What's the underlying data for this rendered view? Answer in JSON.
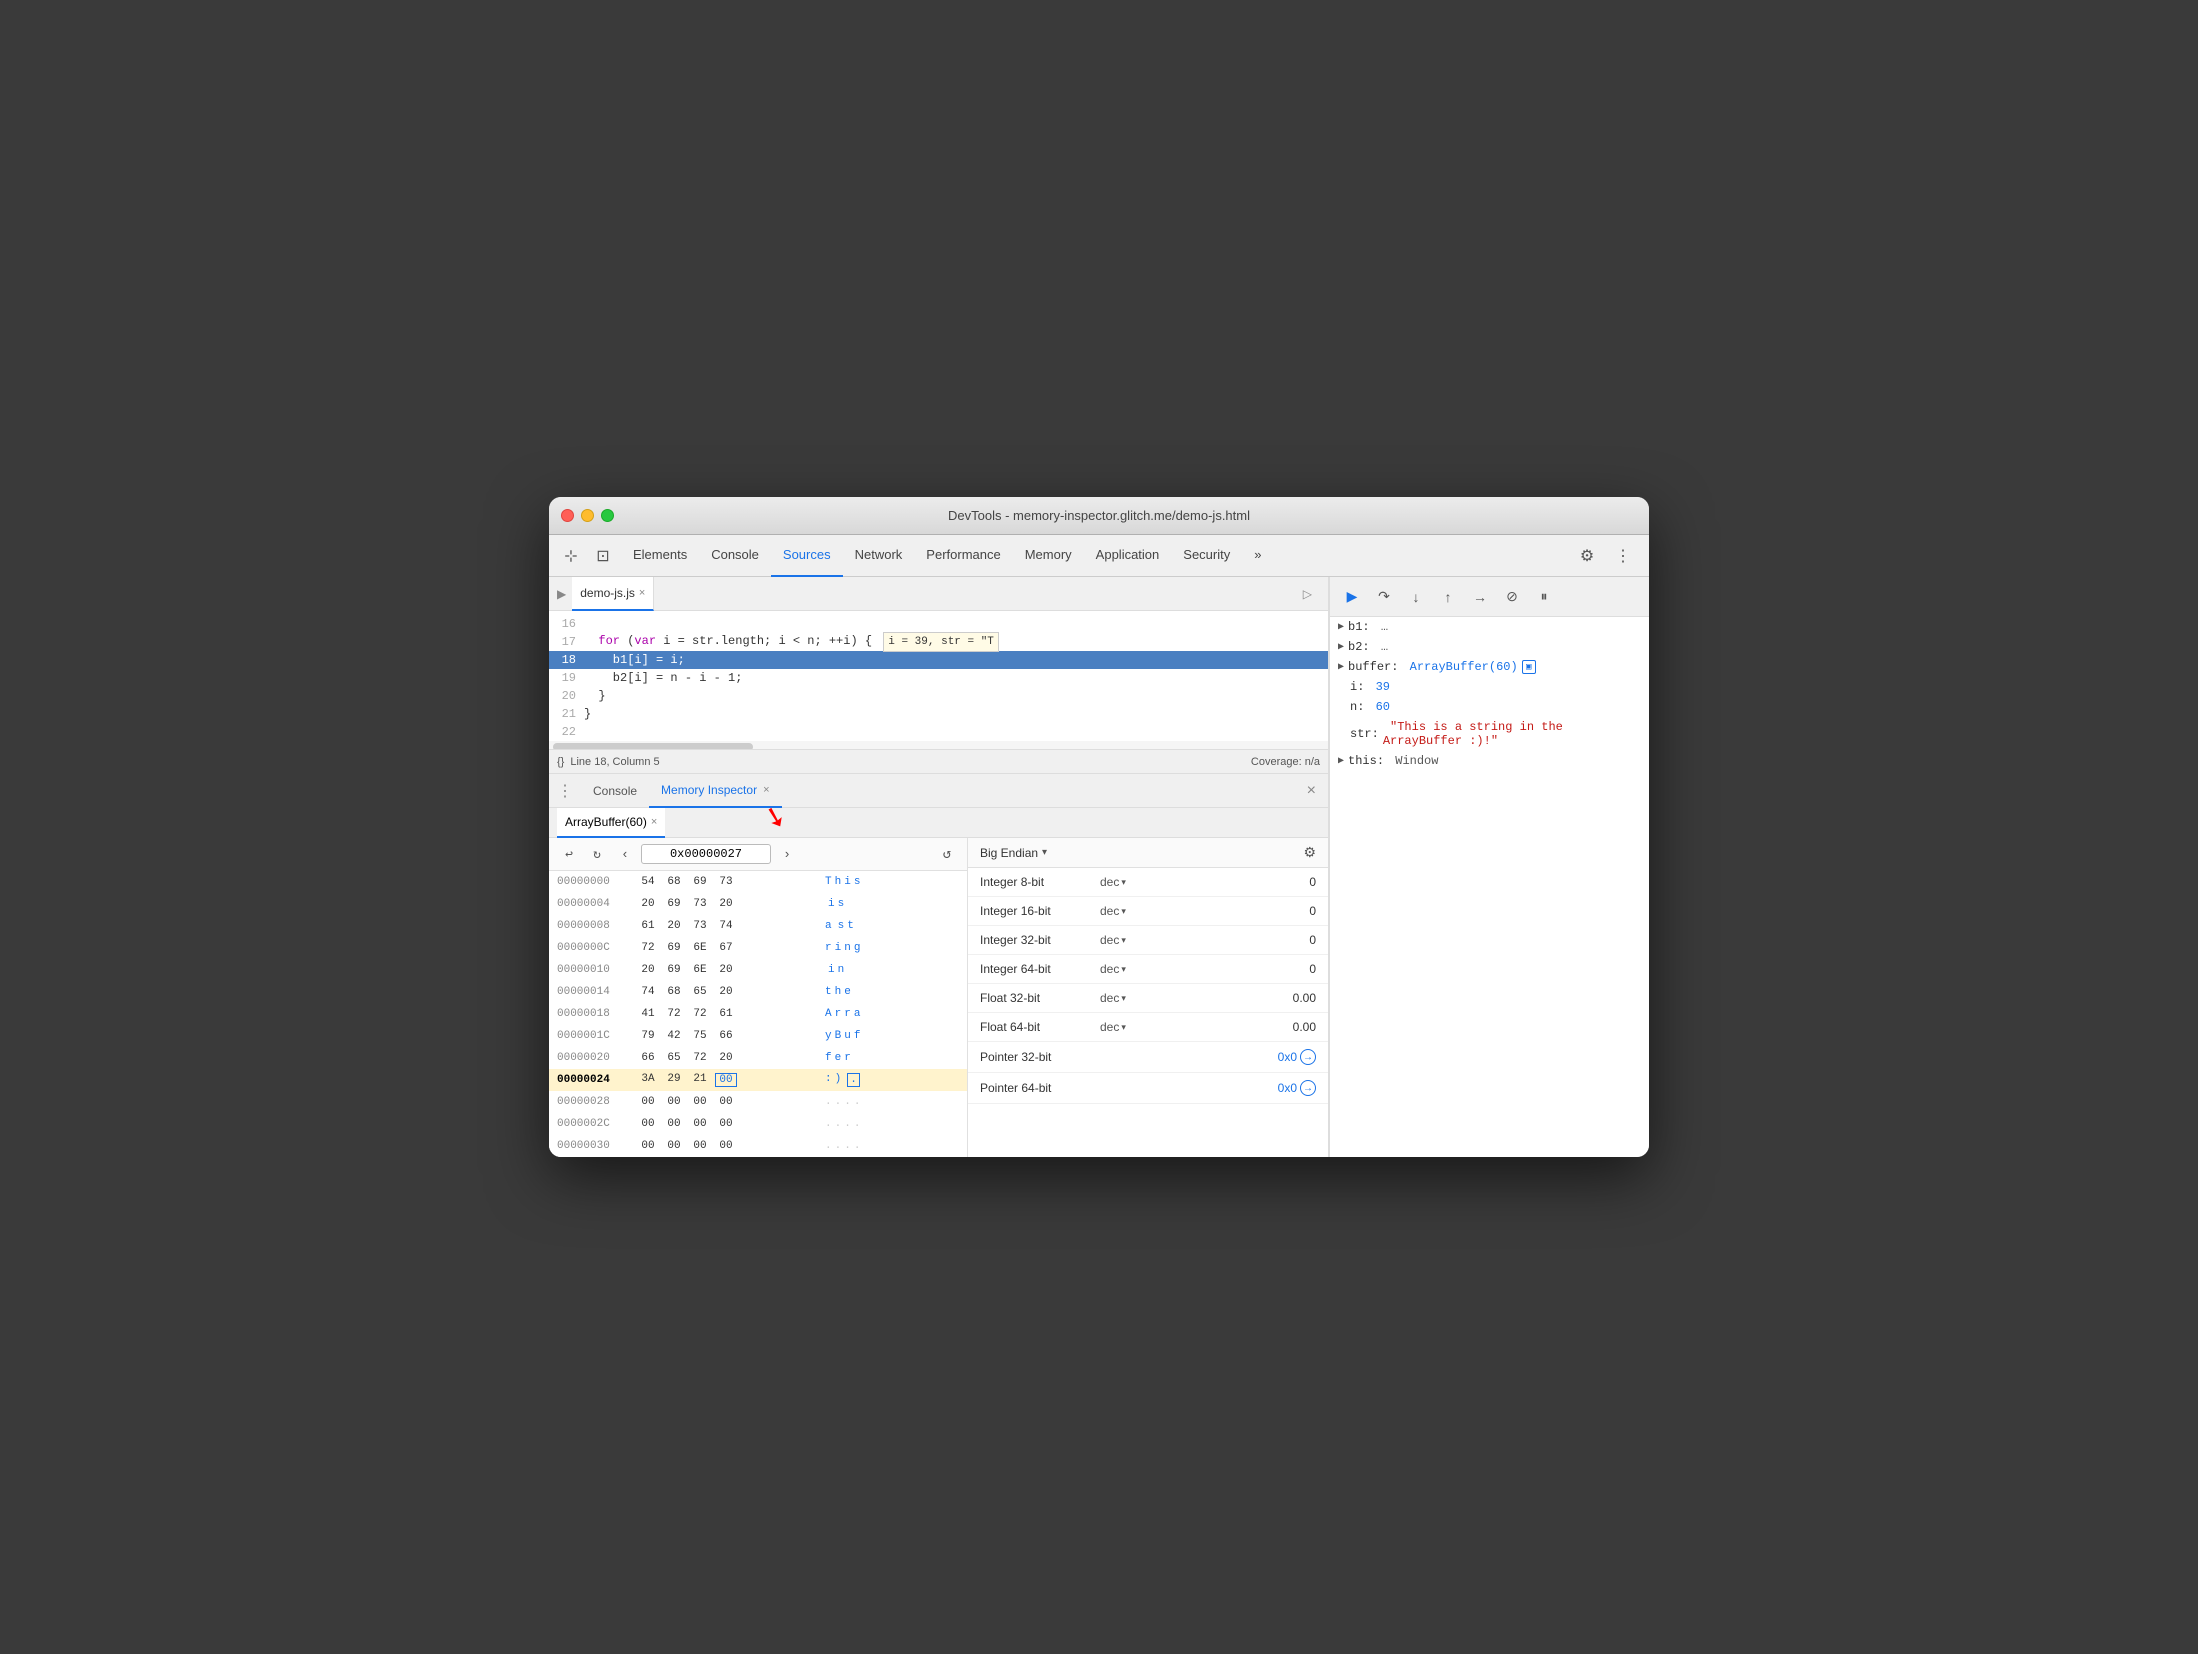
{
  "window": {
    "title": "DevTools - memory-inspector.glitch.me/demo-js.html"
  },
  "devtools_tabs": {
    "items": [
      {
        "label": "Elements",
        "active": false
      },
      {
        "label": "Console",
        "active": false
      },
      {
        "label": "Sources",
        "active": true
      },
      {
        "label": "Network",
        "active": false
      },
      {
        "label": "Performance",
        "active": false
      },
      {
        "label": "Memory",
        "active": false
      },
      {
        "label": "Application",
        "active": false
      },
      {
        "label": "Security",
        "active": false
      }
    ]
  },
  "source_file": {
    "name": "demo-js.js",
    "lines": [
      {
        "num": "16",
        "content": ""
      },
      {
        "num": "17",
        "content": "  for (var i = str.length; i < n; ++i) {",
        "tooltip": "i = 39, str = \"T"
      },
      {
        "num": "18",
        "content": "    b1[i] = i;",
        "highlighted": true
      },
      {
        "num": "19",
        "content": "    b2[i] = n - i - 1;"
      },
      {
        "num": "20",
        "content": "  }"
      },
      {
        "num": "21",
        "content": "}"
      },
      {
        "num": "22",
        "content": ""
      }
    ]
  },
  "statusbar": {
    "position": "Line 18, Column 5",
    "coverage": "Coverage: n/a"
  },
  "bottom_tabs": {
    "items": [
      {
        "label": "Console",
        "active": false
      },
      {
        "label": "Memory Inspector",
        "active": true
      }
    ]
  },
  "memory_inspector": {
    "buffer_tab": "ArrayBuffer(60)",
    "address": "0x00000027",
    "rows": [
      {
        "addr": "00000000",
        "bytes": [
          "54",
          "68",
          "69",
          "73"
        ],
        "ascii": [
          "T",
          "h",
          "i",
          "s"
        ],
        "bold": false
      },
      {
        "addr": "00000004",
        "bytes": [
          "20",
          "69",
          "73",
          "20"
        ],
        "ascii": [
          " ",
          "i",
          "s",
          " "
        ],
        "bold": false
      },
      {
        "addr": "00000008",
        "bytes": [
          "61",
          "20",
          "73",
          "74"
        ],
        "ascii": [
          "a",
          " ",
          "s",
          "t"
        ],
        "bold": false
      },
      {
        "addr": "0000000C",
        "bytes": [
          "72",
          "69",
          "6E",
          "67"
        ],
        "ascii": [
          "r",
          "i",
          "n",
          "g"
        ],
        "bold": false
      },
      {
        "addr": "00000010",
        "bytes": [
          "20",
          "69",
          "6E",
          "20"
        ],
        "ascii": [
          " ",
          "i",
          "n",
          " "
        ],
        "bold": false
      },
      {
        "addr": "00000014",
        "bytes": [
          "74",
          "68",
          "65",
          "20"
        ],
        "ascii": [
          "t",
          "h",
          "e",
          " "
        ],
        "bold": false
      },
      {
        "addr": "00000018",
        "bytes": [
          "41",
          "72",
          "72",
          "61"
        ],
        "ascii": [
          "A",
          "r",
          "r",
          "a"
        ],
        "bold": false
      },
      {
        "addr": "0000001C",
        "bytes": [
          "79",
          "42",
          "75",
          "66"
        ],
        "ascii": [
          "y",
          "B",
          "u",
          "f"
        ],
        "bold": false
      },
      {
        "addr": "00000020",
        "bytes": [
          "66",
          "65",
          "72",
          "20"
        ],
        "ascii": [
          "f",
          "e",
          "r",
          " "
        ],
        "bold": false
      },
      {
        "addr": "00000024",
        "bytes": [
          "3A",
          "29",
          "21",
          "00"
        ],
        "ascii": [
          ":",
          ")",
          " ",
          "[.]"
        ],
        "bold": true,
        "selected_byte": 3
      },
      {
        "addr": "00000028",
        "bytes": [
          "00",
          "00",
          "00",
          "00"
        ],
        "ascii": [
          ".",
          ".",
          ".",
          "."
        ],
        "bold": false
      },
      {
        "addr": "0000002C",
        "bytes": [
          "00",
          "00",
          "00",
          "00"
        ],
        "ascii": [
          ".",
          ".",
          ".",
          "."
        ],
        "bold": false
      },
      {
        "addr": "00000030",
        "bytes": [
          "00",
          "00",
          "00",
          "00"
        ],
        "ascii": [
          ".",
          ".",
          ".",
          "."
        ],
        "bold": false
      }
    ]
  },
  "inspector": {
    "endian": "Big Endian",
    "rows": [
      {
        "label": "Integer 8-bit",
        "type": "dec",
        "value": "0"
      },
      {
        "label": "Integer 16-bit",
        "type": "dec",
        "value": "0"
      },
      {
        "label": "Integer 32-bit",
        "type": "dec",
        "value": "0"
      },
      {
        "label": "Integer 64-bit",
        "type": "dec",
        "value": "0"
      },
      {
        "label": "Float 32-bit",
        "type": "dec",
        "value": "0.00"
      },
      {
        "label": "Float 64-bit",
        "type": "dec",
        "value": "0.00"
      },
      {
        "label": "Pointer 32-bit",
        "type": "",
        "value": "0x0",
        "link": true
      },
      {
        "label": "Pointer 64-bit",
        "type": "",
        "value": "0x0",
        "link": true
      }
    ]
  },
  "scope": {
    "items": [
      {
        "key": "b1:",
        "value": "…",
        "indent": false,
        "arrow": true
      },
      {
        "key": "b2:",
        "value": "…",
        "indent": false,
        "arrow": true
      },
      {
        "key": "buffer:",
        "value": "ArrayBuffer(60)",
        "indent": false,
        "arrow": true,
        "mem_icon": true
      },
      {
        "key": "i:",
        "value": "39",
        "indent": true,
        "arrow": false
      },
      {
        "key": "n:",
        "value": "60",
        "indent": true,
        "arrow": false
      },
      {
        "key": "str:",
        "value": "\"This is a string in the ArrayBuffer :)!\"",
        "indent": true,
        "arrow": false,
        "str": true
      },
      {
        "key": "▶ this:",
        "value": "Window",
        "indent": false,
        "arrow": false
      }
    ]
  }
}
